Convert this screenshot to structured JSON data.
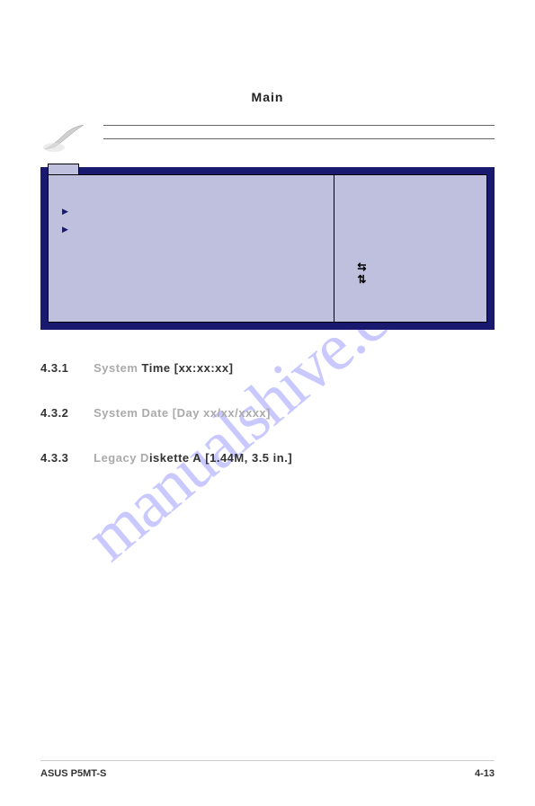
{
  "header": {
    "menu_title": "Main"
  },
  "sections": [
    {
      "num": "4.3.1",
      "title": "System Time",
      "value": "[xx:xx:xx]"
    },
    {
      "num": "4.3.2",
      "title": "System Date",
      "value": "[Day xx/xx/xxxx]"
    },
    {
      "num": "4.3.3",
      "title": "Legacy Diskette A",
      "value": "[1.44M, 3.5 in.]"
    }
  ],
  "footer": {
    "left": "ASUS P5MT-S",
    "right": "4-13"
  },
  "watermark": "manualshive.com"
}
